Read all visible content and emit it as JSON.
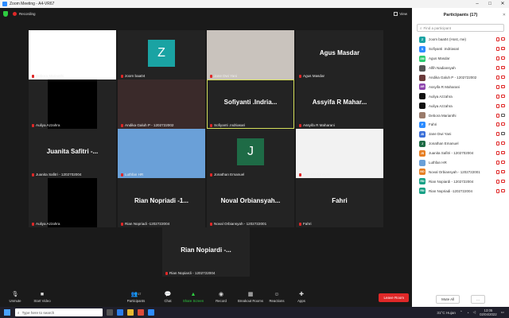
{
  "window": {
    "title": "Zoom Meeting - A4-VR67"
  },
  "topbar": {
    "recording": "Recording",
    "view": "View"
  },
  "tiles": [
    {
      "name": "Debora Marianthi",
      "type": "video",
      "bg": "#ffffff"
    },
    {
      "name": "zoom baa04",
      "type": "avatar",
      "initial": "Z",
      "color": "#1aa3a3"
    },
    {
      "name": "Jane Dwi Yani",
      "type": "video",
      "bg": "#c9c3bd"
    },
    {
      "name": "Agus Masdar",
      "type": "name",
      "big": "Agus Masdar"
    },
    {
      "name": "Auliya Azzahra",
      "type": "black"
    },
    {
      "name": "Andika Galuh P - 1202722002",
      "type": "video",
      "bg": "#3a2a2a"
    },
    {
      "name": "Sofiyanti .Indriasari",
      "type": "name",
      "big": "Sofiyanti .Indria...",
      "active": true
    },
    {
      "name": "Assyifa R Maharani",
      "type": "name",
      "big": "Assyifa R Mahar..."
    },
    {
      "name": "Juanita Safitri - 1202702004",
      "type": "name",
      "big": "Juanita Safitri -..."
    },
    {
      "name": "Luthfan HR",
      "type": "video",
      "bg": "#6aa0d8"
    },
    {
      "name": "Jonathan Emanuel",
      "type": "avatar",
      "initial": "J",
      "color": "#1e6b46"
    },
    {
      "name": "Alfih Nadiansyah",
      "type": "video",
      "bg": "#f2f2f2"
    },
    {
      "name": "Auliya Azzahra",
      "type": "black"
    },
    {
      "name": "Rian Nopriadi -1202722004",
      "type": "name",
      "big": "Rian Nopriadi -1..."
    },
    {
      "name": "Noval Orbiansyah - 1202722001",
      "type": "name",
      "big": "Noval Orbiansyah..."
    },
    {
      "name": "Fahri",
      "type": "name",
      "big": "Fahri"
    },
    {
      "name": "Rian Nopiardi - 1202722004",
      "type": "name",
      "big": "Rian Nopiardi -..."
    }
  ],
  "toolbar": {
    "unmute": "Unmute",
    "start_video": "Start Video",
    "participants": "Participants",
    "participants_count": "17",
    "chat": "Chat",
    "share": "Share Screen",
    "record": "Record",
    "breakout": "Breakout Rooms",
    "reactions": "Reactions",
    "apps": "Apps",
    "leave": "Leave Room"
  },
  "panel": {
    "title": "Participants (17)",
    "search_placeholder": "Find a participant",
    "participants": [
      {
        "name": "zoom baa04 (Host, me)",
        "initials": "Z",
        "color": "#1aa3a3",
        "video": false
      },
      {
        "name": "Sofiyanti .Indriasari",
        "initials": "S",
        "color": "#2d8cff",
        "video": false
      },
      {
        "name": "Agus Masdar",
        "initials": "AM",
        "color": "#2ecc71",
        "video": false
      },
      {
        "name": "Alfih Nadiansyah",
        "initials": "",
        "color": "#555555",
        "video": false
      },
      {
        "name": "Andika Galuh P - 1202722002",
        "initials": "",
        "color": "#6b3a3a",
        "video": false
      },
      {
        "name": "Assyifa R Maharani",
        "initials": "AR",
        "color": "#8e44ad",
        "video": false
      },
      {
        "name": "Auliya Azzahra",
        "initials": "",
        "color": "#111111",
        "video": false
      },
      {
        "name": "Auliya Azzahra",
        "initials": "",
        "color": "#111111",
        "video": false
      },
      {
        "name": "Debora Marianthi",
        "initials": "",
        "color": "#9a7b6a",
        "video": true
      },
      {
        "name": "Fahri",
        "initials": "F",
        "color": "#2d8cff",
        "video": false
      },
      {
        "name": "Jane Dwi Yani",
        "initials": "JD",
        "color": "#3a6fd8",
        "video": true
      },
      {
        "name": "Jonathan Emanuel",
        "initials": "J",
        "color": "#1e6b46",
        "video": false
      },
      {
        "name": "Juanita Safitri - 1202702004",
        "initials": "JS",
        "color": "#e67e22",
        "video": false
      },
      {
        "name": "Luthfan HR",
        "initials": "",
        "color": "#6aa0d8",
        "video": false
      },
      {
        "name": "Noval Orbiansyah - 1202722001",
        "initials": "NO",
        "color": "#e67e22",
        "video": false
      },
      {
        "name": "Rian Nopiardi - 1202722004",
        "initials": "RN",
        "color": "#16a085",
        "video": false
      },
      {
        "name": "Rian Nopriadi -1202722004",
        "initials": "RN",
        "color": "#16a085",
        "video": false
      }
    ],
    "mute_all": "Mute All",
    "more": "..."
  },
  "taskbar": {
    "search": "Type here to search",
    "weather": "31°C  Hujan",
    "time": "13:05",
    "date": "02/04/2022"
  }
}
